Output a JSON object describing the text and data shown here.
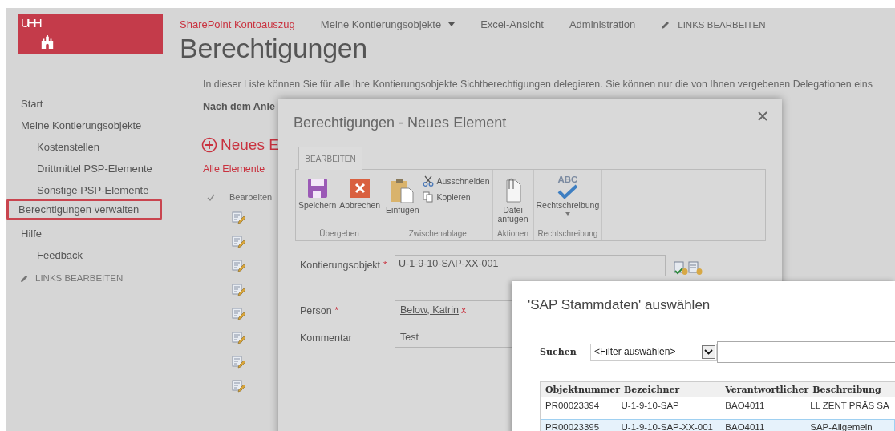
{
  "logo": {
    "text": "UHH"
  },
  "top_nav": [
    {
      "label": "SharePoint Kontoauszug",
      "selected": true,
      "kind": "link"
    },
    {
      "label": "Meine Kontierungsobjekte",
      "selected": false,
      "kind": "dropdown"
    },
    {
      "label": "Excel-Ansicht",
      "selected": false,
      "kind": "link"
    },
    {
      "label": "Administration",
      "selected": false,
      "kind": "link"
    },
    {
      "label": "LINKS BEARBEITEN",
      "selected": false,
      "kind": "edit"
    }
  ],
  "page_title": "Berechtigungen",
  "sidebar": {
    "items": [
      {
        "label": "Start",
        "selected": false
      },
      {
        "label": "Meine Kontierungsobjekte",
        "selected": false,
        "children": [
          {
            "label": "Kostenstellen",
            "selected": false
          },
          {
            "label": "Drittmittel PSP-Elemente",
            "selected": false
          },
          {
            "label": "Sonstige PSP-Elemente",
            "selected": false
          }
        ]
      },
      {
        "label": "Berechtigungen verwalten",
        "selected": true
      },
      {
        "label": "Hilfe",
        "selected": false,
        "children": [
          {
            "label": "Feedback",
            "selected": false
          }
        ]
      }
    ],
    "edit_links": "LINKS BEARBEITEN"
  },
  "intro": "In dieser Liste können Sie für alle Ihre Kontierungsobjekte Sichtberechtigungen delegieren. Sie können nur die von Ihnen vergebenen Delegationen eins",
  "note": "Nach dem Anle",
  "new_item": "Neues E",
  "view": "Alle Elemente",
  "list": {
    "header": "Bearbeiten",
    "rows": [
      {
        "kind": "edit"
      },
      {
        "kind": "edit"
      },
      {
        "kind": "edit"
      },
      {
        "kind": "edit"
      },
      {
        "kind": "edit"
      },
      {
        "kind": "edit"
      },
      {
        "kind": "edit"
      },
      {
        "kind": "edit"
      }
    ]
  },
  "dialog": {
    "title": "Berechtigungen - Neues Element",
    "ribbon_tab": "BEARBEITEN",
    "groups": [
      {
        "label": "Übergeben",
        "buttons": [
          {
            "kind": "save",
            "label": "Speichern"
          },
          {
            "kind": "cancel",
            "label": "Abbrechen"
          }
        ]
      },
      {
        "label": "Zwischenablage",
        "buttons": [
          {
            "kind": "paste",
            "label": "Einfügen"
          },
          {
            "kind": "cut",
            "label": "Ausschneiden"
          },
          {
            "kind": "copy",
            "label": "Kopieren"
          }
        ]
      },
      {
        "label": "Aktionen",
        "buttons": [
          {
            "kind": "attach",
            "label": "Datei anfügen"
          }
        ]
      },
      {
        "label": "Rechtschreibung",
        "buttons": [
          {
            "kind": "spelling",
            "label": "Rechtschreibung",
            "badge": "ABC"
          }
        ]
      }
    ],
    "fields": [
      {
        "kind": "lookup",
        "label": "Kontierungsobjekt",
        "marker": "*",
        "value": "U-1-9-10-SAP-XX-001"
      },
      {
        "kind": "person",
        "label": "Person",
        "marker": "*",
        "value": "Below, Katrin",
        "remove": "x"
      },
      {
        "kind": "text",
        "label": "Kommentar",
        "value": "Test"
      }
    ]
  },
  "picker": {
    "title": "'SAP Stammdaten' auswählen",
    "search_label": "Suchen",
    "filter": "<Filter auswählen>",
    "columns": [
      "Objektnummer",
      "Bezeichner",
      "Verantwortlicher",
      "Beschreibung"
    ],
    "rows": [
      {
        "cells": [
          "PR00023394",
          "U-1-9-10-SAP",
          "BAO4011",
          "LL ZENT PRÄS SA"
        ],
        "selected": false
      },
      {
        "cells": [
          "PR00023395",
          "U-1-9-10-SAP-XX-001",
          "BAO4011",
          "SAP-Allgemein"
        ],
        "selected": true
      }
    ]
  }
}
